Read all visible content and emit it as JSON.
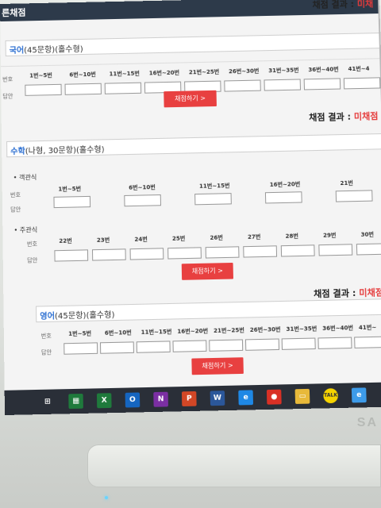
{
  "header": {
    "title": "른채점",
    "result_label": "채점 결과 :",
    "result_status": "미채"
  },
  "sections": [
    {
      "id": "korean",
      "subject": "국어",
      "info": "(45문항)(홀수형)",
      "number_label": "번호",
      "answer_label": "답안",
      "ranges": [
        "1번~5번",
        "6번~10번",
        "11번~15번",
        "16번~20번",
        "21번~25번",
        "26번~30번",
        "31번~35번",
        "36번~40번",
        "41번~4"
      ],
      "button": "채점하기 >"
    },
    {
      "id": "math",
      "subject": "수학",
      "info": "(나형, 30문항)(홀수형)",
      "result_label": "채점 결과 :",
      "result_status": "미채점",
      "objective_label": "• 객관식",
      "number_label": "번호",
      "answer_label": "답안",
      "obj_ranges": [
        "1번~5번",
        "6번~10번",
        "11번~15번",
        "16번~20번",
        "21번"
      ],
      "subjective_label": "• 주관식",
      "subj_items": [
        "22번",
        "23번",
        "24번",
        "25번",
        "26번",
        "27번",
        "28번",
        "29번",
        "30번"
      ],
      "button": "채점하기 >"
    },
    {
      "id": "english",
      "subject": "영어",
      "info": "(45문항)(홀수형)",
      "result_label": "채점 결과 :",
      "result_status": "미채점",
      "number_label": "번호",
      "answer_label": "답안",
      "ranges": [
        "1번~5번",
        "6번~10번",
        "11번~15번",
        "16번~20번",
        "21번~25번",
        "26번~30번",
        "31번~35번",
        "36번~40번",
        "41번~"
      ],
      "button": "채점하기 >"
    }
  ],
  "taskbar": {
    "icons": [
      {
        "name": "windows-start-icon",
        "glyph": "⊞",
        "color": "#2a2f38"
      },
      {
        "name": "excel-green-icon",
        "glyph": "▦",
        "color": "#1f7a3c"
      },
      {
        "name": "excel-icon",
        "glyph": "X",
        "color": "#1f7a3c"
      },
      {
        "name": "outlook-icon",
        "glyph": "O",
        "color": "#1565c0"
      },
      {
        "name": "onenote-icon",
        "glyph": "N",
        "color": "#7b2fa3"
      },
      {
        "name": "powerpoint-icon",
        "glyph": "P",
        "color": "#d24726"
      },
      {
        "name": "word-icon",
        "glyph": "W",
        "color": "#2b579a"
      },
      {
        "name": "internet-explorer-icon",
        "glyph": "e",
        "color": "#1e88e5"
      },
      {
        "name": "chrome-icon",
        "glyph": "●",
        "color": "#d93025"
      },
      {
        "name": "file-explorer-icon",
        "glyph": "▭",
        "color": "#e8b93a"
      },
      {
        "name": "kakaotalk-icon",
        "glyph": "TALK",
        "color": "#f5d300"
      },
      {
        "name": "internet-explorer-window-icon",
        "glyph": "e",
        "color": "#3d9be9"
      }
    ]
  },
  "device": {
    "brand": "SA"
  }
}
